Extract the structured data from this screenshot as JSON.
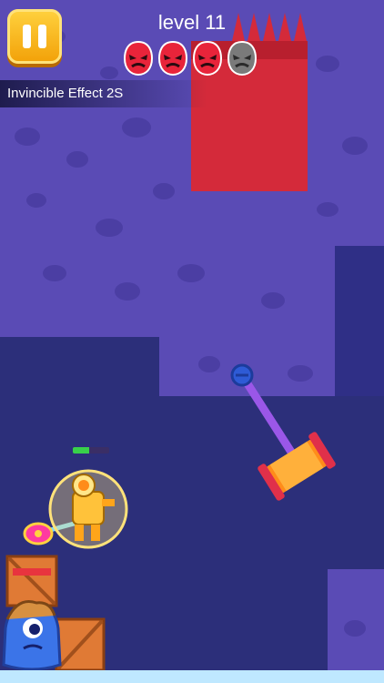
{
  "hud": {
    "level_label": "level 11",
    "effect_text": "Invincible Effect 2S",
    "enemies_total": 4,
    "enemies_defeated": 3,
    "player_health_fraction": 0.45,
    "icons": {
      "pause": "pause-icon",
      "enemy_alive": "angry-red-face-icon",
      "enemy_gone": "grey-face-icon"
    }
  },
  "colors": {
    "background": "#2c2f7a",
    "rock": "#5a4bb5",
    "spike_block": "#d42a3a",
    "pause_button": "#f7b51c",
    "crate": "#e07a35",
    "health": "#38d04a"
  }
}
